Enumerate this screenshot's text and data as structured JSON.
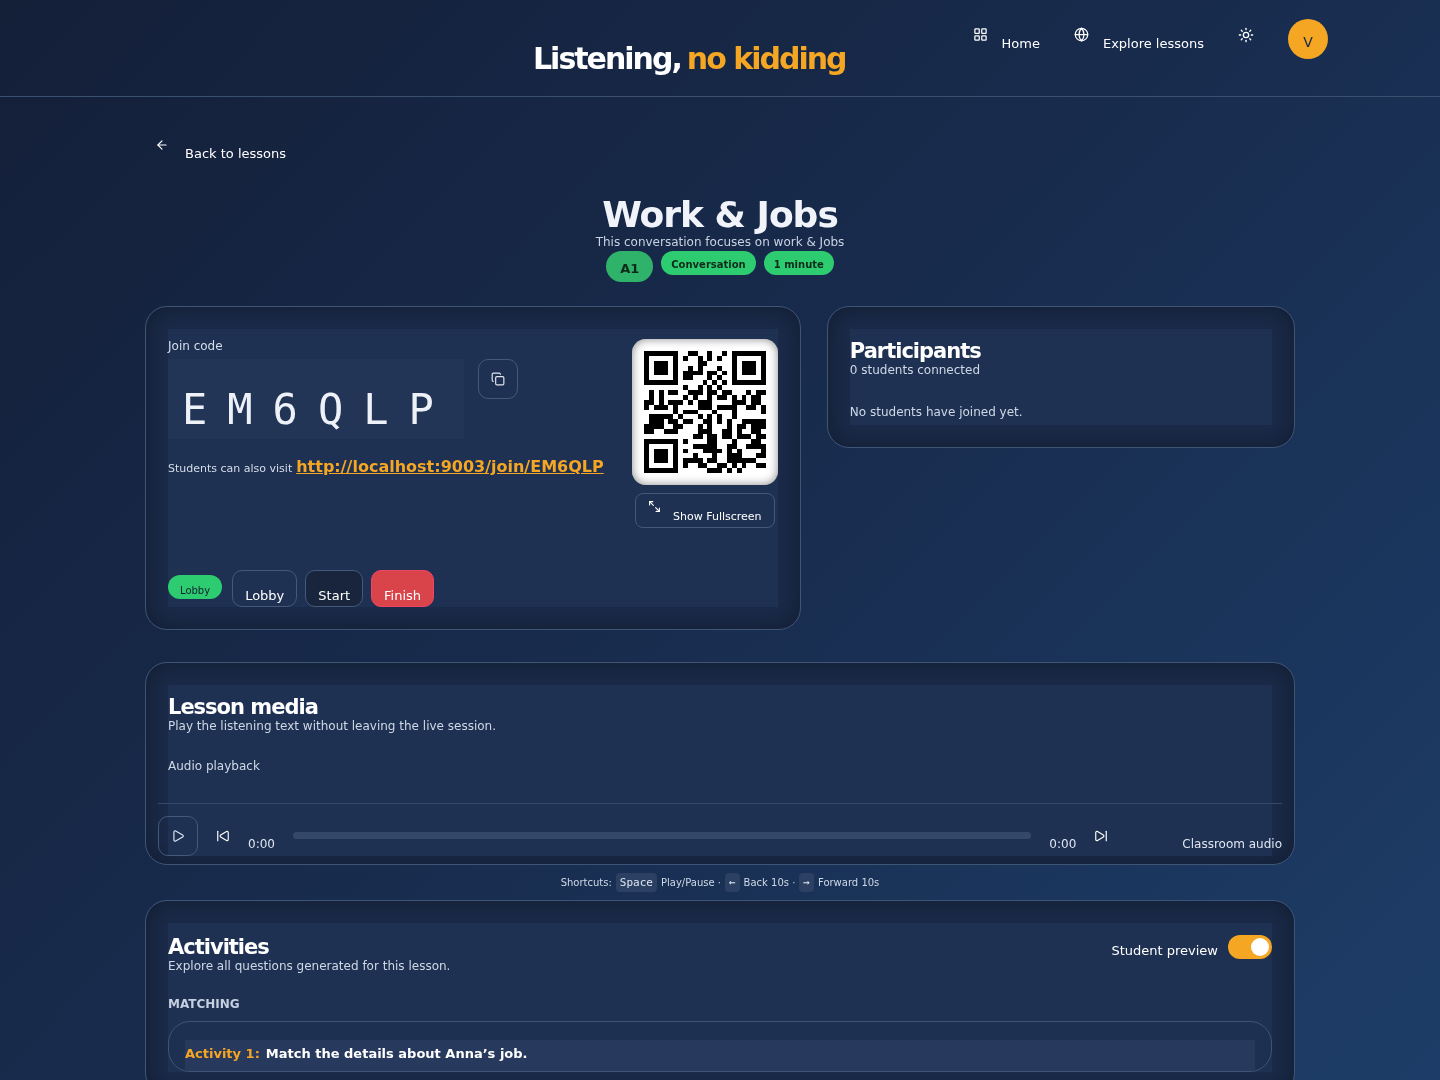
{
  "header": {
    "logo": {
      "first": "Listening,",
      "second": "no kidding"
    },
    "nav": [
      {
        "label": "Home"
      },
      {
        "label": "Explore lessons"
      }
    ],
    "avatar": "V"
  },
  "back_link": "Back to lessons",
  "lesson": {
    "title": "Work & Jobs",
    "description": "This conversation focuses on work & Jobs",
    "tags": [
      "A1",
      "Conversation",
      "1 minute"
    ]
  },
  "session": {
    "join_label": "Join code",
    "code": [
      "E",
      "M",
      "6",
      "Q",
      "L",
      "P"
    ],
    "visit_text": "Students can also visit",
    "visit_link": "http://localhost:9003/join/EM6QLP",
    "fullscreen": "Show Fullscreen",
    "status": "Lobby",
    "controls": [
      {
        "label": "Lobby",
        "kind": "outline"
      },
      {
        "label": "Start",
        "kind": "dark"
      },
      {
        "label": "Finish",
        "kind": "danger"
      }
    ]
  },
  "participants": {
    "title": "Participants",
    "count": "0 students connected",
    "empty": "No students have joined yet."
  },
  "media": {
    "title": "Lesson media",
    "subtitle": "Play the listening text without leaving the live session.",
    "label": "Audio playback",
    "current_time": "0:00",
    "duration": "0:00",
    "level": 0,
    "source": "Classroom audio",
    "shortcuts": {
      "label": "Shortcuts:",
      "items": [
        {
          "key": "Space",
          "action": "Play/Pause ·"
        },
        {
          "key": "←",
          "action": "Back 10s ·"
        },
        {
          "key": "→",
          "action": "Forward 10s"
        }
      ]
    }
  },
  "activities": {
    "title": "Activities",
    "subtitle": "Explore all questions generated for this lesson.",
    "preview_label": "Student preview",
    "preview_on": true,
    "section": "MATCHING",
    "items": [
      {
        "number": "Activity 1:",
        "text": "Match the details about Anna’s job."
      }
    ]
  }
}
